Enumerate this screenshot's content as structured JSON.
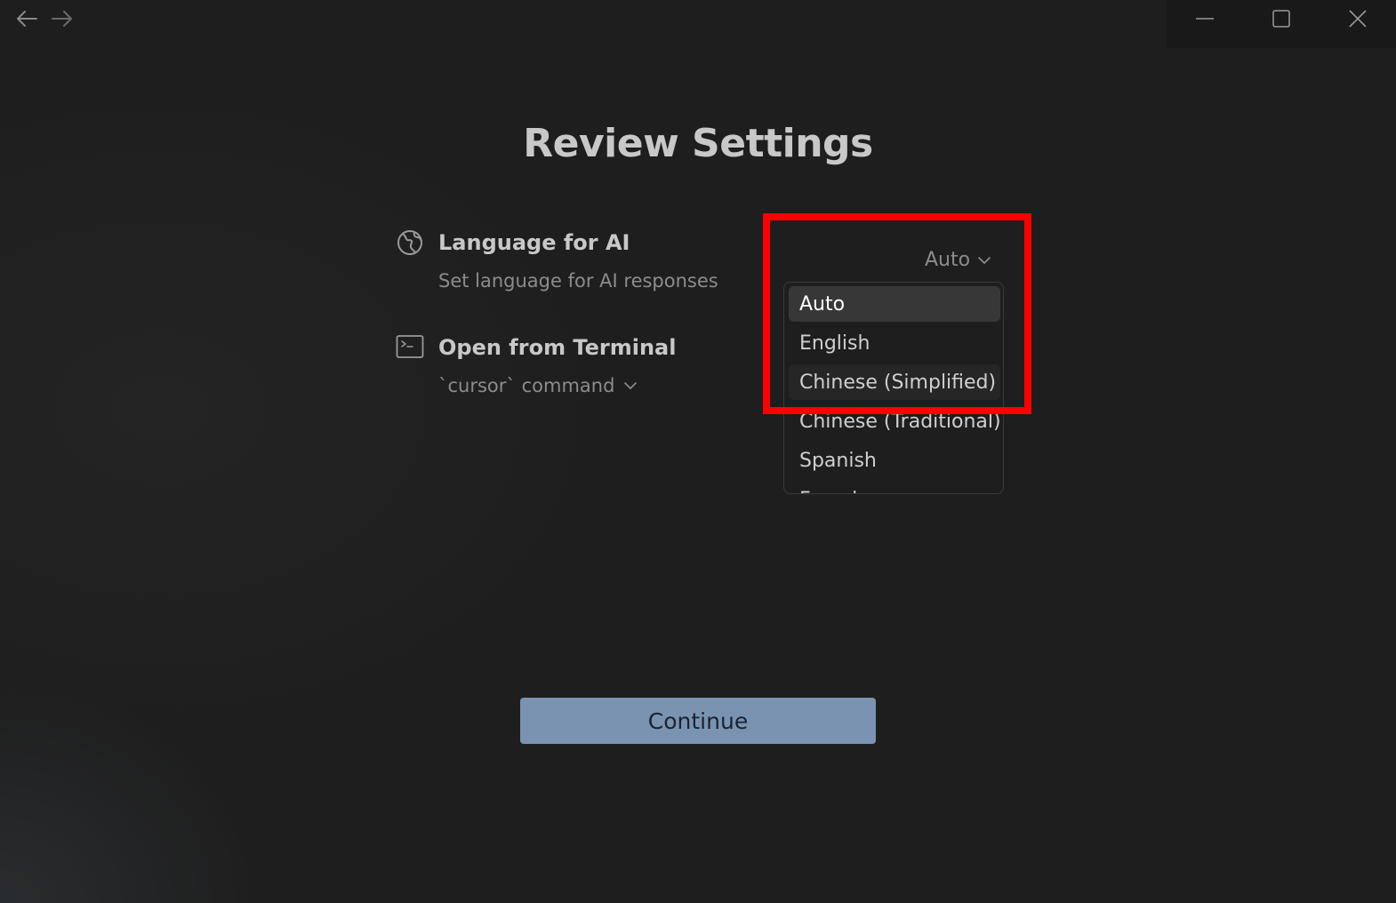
{
  "titlebar": {
    "back_icon": "arrow-left-icon",
    "forward_icon": "arrow-right-icon",
    "minimize_icon": "minimize-icon",
    "maximize_icon": "maximize-icon",
    "close_icon": "close-icon"
  },
  "page": {
    "title": "Review Settings"
  },
  "settings": {
    "language": {
      "icon": "globe-icon",
      "title": "Language for AI",
      "description": "Set language for AI responses",
      "selected_value": "Auto",
      "options": [
        "Auto",
        "English",
        "Chinese (Simplified)",
        "Chinese (Traditional)",
        "Spanish",
        "French"
      ]
    },
    "terminal": {
      "icon": "terminal-icon",
      "title": "Open from Terminal",
      "value": "`cursor` command"
    }
  },
  "actions": {
    "continue_label": "Continue"
  },
  "colors": {
    "background": "#1e1e1e",
    "accent_button": "#7a93b1",
    "highlight": "#ff0000"
  }
}
